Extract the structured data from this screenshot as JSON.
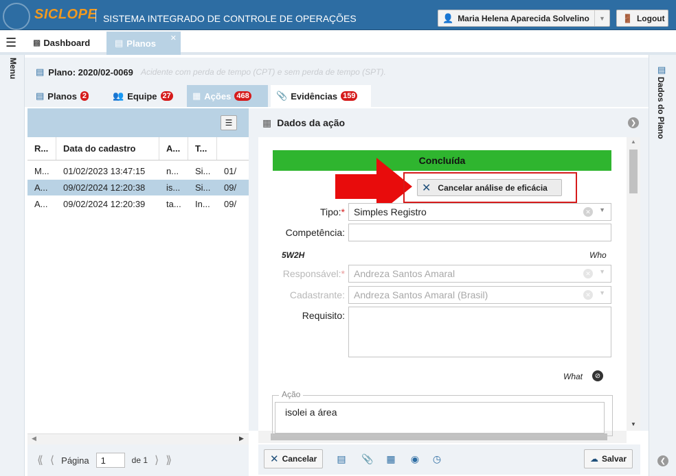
{
  "app": {
    "brand": "SICLOPE",
    "system_title": "SISTEMA INTEGRADO DE CONTROLE DE OPERAÇÕES",
    "user_name": "Maria Helena Aparecida Solvelino",
    "logout_label": "Logout"
  },
  "main_tabs": [
    {
      "label": "Dashboard",
      "icon": "bar-chart-icon"
    },
    {
      "label": "Planos",
      "icon": "map-icon",
      "active": true
    }
  ],
  "menu_label": "Menu",
  "right_panel_label": "Dados do Plano",
  "plan": {
    "title": "Plano: 2020/02-0069",
    "description": "Acidente com perda de tempo (CPT) e sem perda de tempo (SPT)."
  },
  "inner_tabs": [
    {
      "label": "Planos",
      "count": "2"
    },
    {
      "label": "Equipe",
      "count": "27"
    },
    {
      "label": "Ações",
      "count": "468",
      "active": true
    },
    {
      "label": "Evidências",
      "count": "159"
    }
  ],
  "grid": {
    "columns": [
      "R...",
      "Data do cadastro",
      "A...",
      "T..."
    ],
    "rows": [
      {
        "r": "M...",
        "date": "01/02/2023 13:47:15",
        "a": "n...",
        "t": "Si...",
        "extra": "01/"
      },
      {
        "r": "A...",
        "date": "09/02/2024 12:20:38",
        "a": "is...",
        "t": "Si...",
        "extra": "09/",
        "selected": true
      },
      {
        "r": "A...",
        "date": "09/02/2024 12:20:39",
        "a": "ta...",
        "t": "In...",
        "extra": "09/"
      }
    ],
    "pager": {
      "page_label": "Página",
      "page_value": "1",
      "of_label": "de 1"
    }
  },
  "action_panel": {
    "title": "Dados da ação",
    "status": "Concluída",
    "status_color": "#2fb52f",
    "cancel_analysis_label": "Cancelar análise de eficácia",
    "fields": {
      "tipo_label": "Tipo:",
      "tipo_value": "Simples Registro",
      "competencia_label": "Competência:",
      "competencia_value": "",
      "section_5w2h": "5W2H",
      "section_who": "Who",
      "responsavel_label": "Responsável:",
      "responsavel_value": "Andreza Santos Amaral",
      "cadastrante_label": "Cadastrante:",
      "cadastrante_value": "Andreza Santos Amaral (Brasil)",
      "requisito_label": "Requisito:",
      "requisito_value": "",
      "section_what": "What",
      "acao_legend": "Ação",
      "acao_value": "isolei a área"
    },
    "footer": {
      "cancel_label": "Cancelar",
      "save_label": "Salvar"
    }
  },
  "colors": {
    "topbar": "#2d6da3",
    "brand": "#f29a1f",
    "tab_active": "#b9d2e4",
    "badge": "#d51b1b",
    "highlight": "#d61a1a"
  }
}
